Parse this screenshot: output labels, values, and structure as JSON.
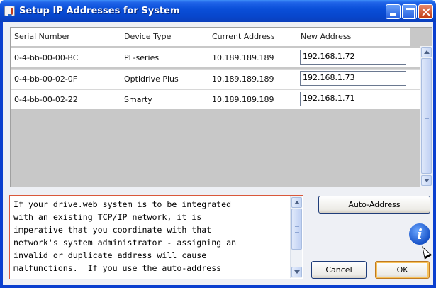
{
  "window": {
    "title": "Setup IP Addresses for System",
    "buttons": [
      "minimize",
      "maximize",
      "close"
    ]
  },
  "table": {
    "headers": {
      "serial": "Serial Number",
      "device": "Device Type",
      "current": "Current Address",
      "new": "New Address"
    },
    "rows": [
      {
        "serial": "0-4-bb-00-00-BC",
        "device": "PL-series",
        "current": "10.189.189.189",
        "new": "192.168.1.72"
      },
      {
        "serial": "0-4-bb-00-02-0F",
        "device": "Optidrive Plus",
        "current": "10.189.189.189",
        "new": "192.168.1.73"
      },
      {
        "serial": "0-4-bb-00-02-22",
        "device": "Smarty",
        "current": "10.189.189.189",
        "new": "192.168.1.71"
      }
    ]
  },
  "message": {
    "text": "If your drive.web system is to be integrated\nwith an existing TCP/IP network, it is\nimperative that you coordinate with that\nnetwork's system administrator - assigning an\ninvalid or duplicate address will cause\nmalfunctions.  If you use the auto-address"
  },
  "actions": {
    "auto_address": "Auto-Address",
    "cancel": "Cancel",
    "ok": "OK"
  },
  "icons": {
    "info": "i"
  },
  "colors": {
    "titlebar": "#0a4fd9",
    "message_border": "#d9583b",
    "table_background": "#c8c8c8"
  }
}
